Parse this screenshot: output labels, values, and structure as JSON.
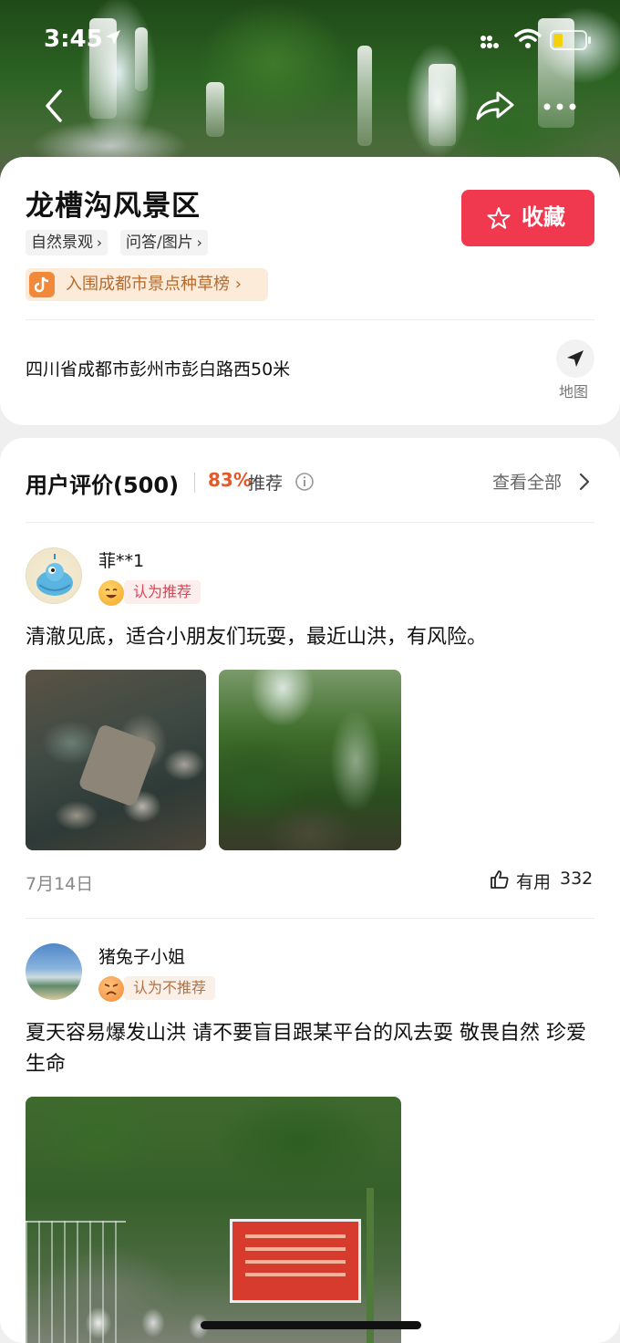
{
  "status": {
    "time": "3:45"
  },
  "hero": {
    "back_icon": "chevron-left-icon",
    "share_icon": "share-icon",
    "more_icon": "more-dots-icon"
  },
  "poi": {
    "title": "龙槽沟风景区",
    "tags": [
      "自然景观",
      "问答/图片"
    ],
    "rank_badge": "入围成都市景点种草榜",
    "favorite_label": "收藏",
    "address": "四川省成都市彭州市彭白路西50米",
    "map_label": "地图"
  },
  "reviews": {
    "title": "用户评价(500)",
    "recommend_percent": "83%",
    "recommend_label": "推荐",
    "view_all": "查看全部",
    "items": [
      {
        "username": "菲**1",
        "verdict": "认为推荐",
        "text": "清澈见底，适合小朋友们玩耍，最近山洪，有风险。",
        "date": "7月14日",
        "useful_label": "有用",
        "useful_count": "332"
      },
      {
        "username": "猪兔子小姐",
        "verdict": "认为不推荐",
        "text": "夏天容易爆发山洪   请不要盲目跟某平台的风去耍  敬畏自然  珍爱生命"
      }
    ]
  },
  "colors": {
    "favorite_bg": "#f0384e",
    "recommend_pct": "#e4592a",
    "rank_badge_bg": "#fdebd9"
  }
}
